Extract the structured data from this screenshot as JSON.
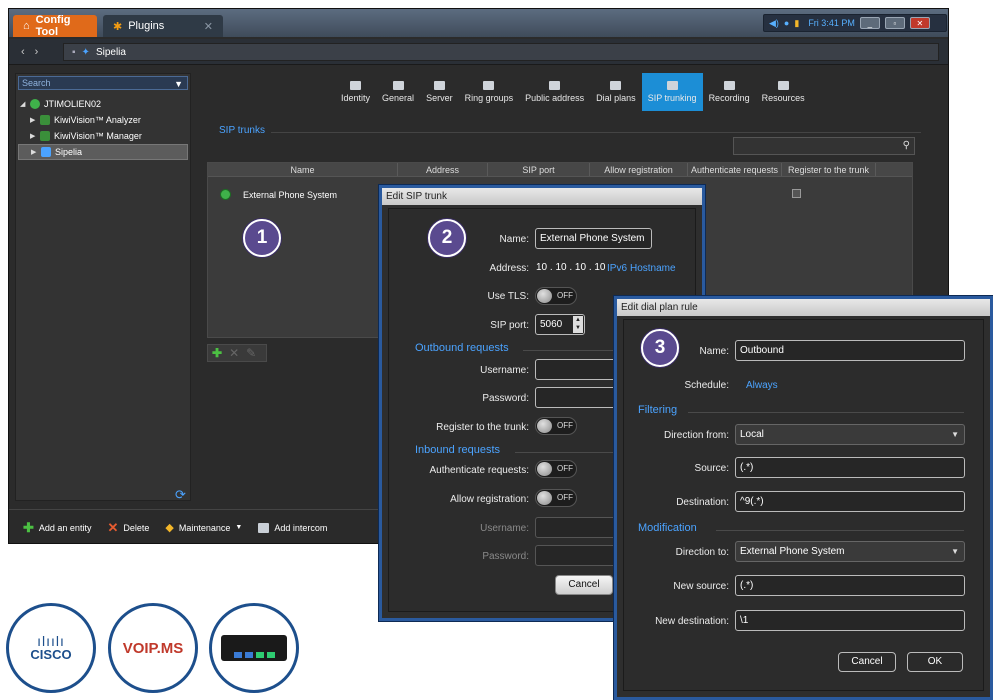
{
  "window": {
    "tabs": [
      {
        "label": "Config Tool"
      },
      {
        "label": "Plugins"
      }
    ],
    "tray_time": "Fri 3:41 PM",
    "address": "Sipelia"
  },
  "tree": {
    "search_placeholder": "Search",
    "items": [
      {
        "label": "JTIMOLIEN02"
      },
      {
        "label": "KiwiVision™ Analyzer"
      },
      {
        "label": "KiwiVision™ Manager"
      },
      {
        "label": "Sipelia"
      }
    ]
  },
  "page_tabs": [
    {
      "label": "Identity"
    },
    {
      "label": "General"
    },
    {
      "label": "Server"
    },
    {
      "label": "Ring groups"
    },
    {
      "label": "Public address"
    },
    {
      "label": "Dial plans"
    },
    {
      "label": "SIP trunking",
      "active": true
    },
    {
      "label": "Recording"
    },
    {
      "label": "Resources"
    }
  ],
  "sip_trunks": {
    "section_title": "SIP trunks",
    "columns": [
      "Name",
      "Address",
      "SIP port",
      "Allow registration",
      "Authenticate requests",
      "Register to the trunk"
    ],
    "rows": [
      {
        "name": "External Phone System"
      }
    ]
  },
  "bottom_bar": {
    "add_entity": "Add an entity",
    "delete": "Delete",
    "maintenance": "Maintenance",
    "add_intercom": "Add intercom"
  },
  "callouts": [
    "1",
    "2",
    "3"
  ],
  "edit_sip_trunk": {
    "title": "Edit SIP trunk",
    "name_label": "Name:",
    "name_value": "External Phone System",
    "address_label": "Address:",
    "address_value": "10 . 10 . 10 . 10",
    "ipv6_link": "IPv6",
    "hostname_link": "Hostname",
    "use_tls_label": "Use TLS:",
    "sip_port_label": "SIP port:",
    "sip_port_value": "5060",
    "outbound_section": "Outbound requests",
    "username_label": "Username:",
    "password_label": "Password:",
    "register_label": "Register to the trunk:",
    "inbound_section": "Inbound requests",
    "authenticate_label": "Authenticate requests:",
    "allow_registration_label": "Allow registration:",
    "inbound_username_label": "Username:",
    "inbound_password_label": "Password:",
    "toggle_off": "OFF",
    "cancel": "Cancel"
  },
  "edit_dial_plan_rule": {
    "title": "Edit dial plan rule",
    "name_label": "Name:",
    "name_value": "Outbound",
    "schedule_label": "Schedule:",
    "schedule_value": "Always",
    "filtering_section": "Filtering",
    "direction_from_label": "Direction from:",
    "direction_from_value": "Local",
    "source_label": "Source:",
    "source_value": "(.*)",
    "destination_label": "Destination:",
    "destination_value": "^9(.*)",
    "modification_section": "Modification",
    "direction_to_label": "Direction to:",
    "direction_to_value": "External Phone System",
    "new_source_label": "New source:",
    "new_source_value": "(.*)",
    "new_destination_label": "New destination:",
    "new_destination_value": "\\1",
    "cancel": "Cancel",
    "ok": "OK"
  },
  "logos": {
    "cisco": "CISCO",
    "voipms": "VOIP.MS"
  },
  "colors": {
    "accent": "#1c8ed6",
    "link": "#4ba3ff",
    "config_tab": "#e06a1a",
    "callout": "#5a4a8f",
    "dialog_border": "#2a5a9e"
  }
}
